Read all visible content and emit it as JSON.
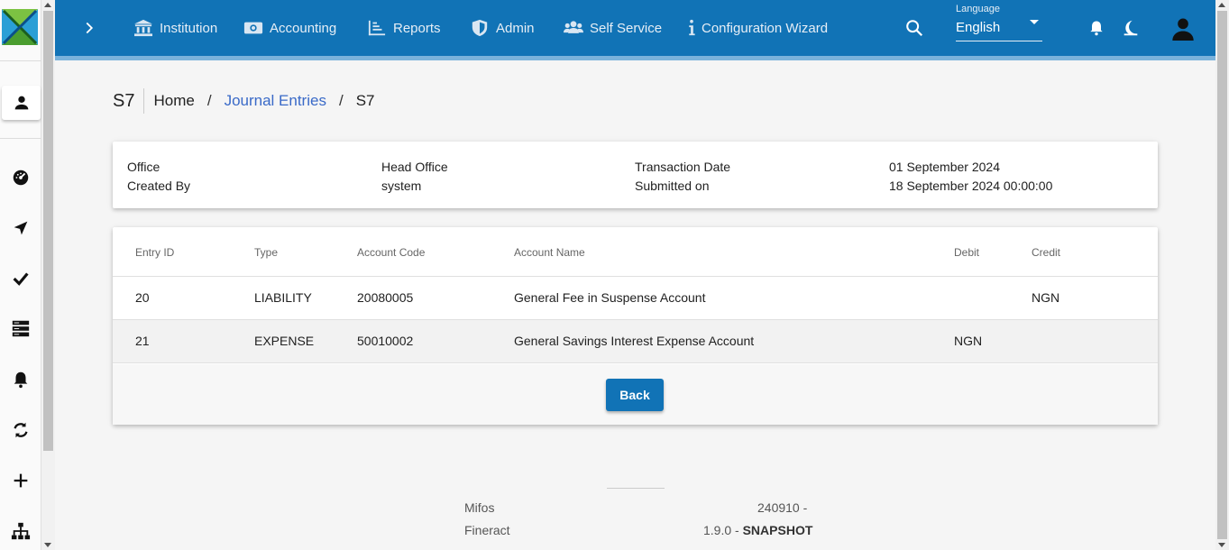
{
  "nav": {
    "items": [
      {
        "label": "Institution",
        "icon": "institution-icon"
      },
      {
        "label": "Accounting",
        "icon": "money-icon"
      },
      {
        "label": "Reports",
        "icon": "reports-icon"
      },
      {
        "label": "Admin",
        "icon": "shield-icon"
      },
      {
        "label": "Self Service",
        "icon": "users-icon"
      },
      {
        "label": "Configuration Wizard",
        "icon": "info-icon"
      }
    ],
    "language_label": "Language",
    "language_value": "English"
  },
  "breadcrumb": {
    "page_title": "S7",
    "home": "Home",
    "section": "Journal Entries",
    "current": "S7"
  },
  "info": {
    "office_label": "Office",
    "created_by_label": "Created By",
    "office_value": "Head Office",
    "created_by_value": "system",
    "transaction_date_label": "Transaction Date",
    "submitted_on_label": "Submitted on",
    "transaction_date_value": "01 September 2024",
    "submitted_on_value": "18 September 2024 00:00:00"
  },
  "table": {
    "headers": [
      "Entry ID",
      "Type",
      "Account Code",
      "Account Name",
      "Debit",
      "Credit"
    ],
    "rows": [
      {
        "entry_id": "20",
        "type": "LIABILITY",
        "account_code": "20080005",
        "account_name": "General Fee in Suspense Account",
        "debit": "",
        "credit": "NGN"
      },
      {
        "entry_id": "21",
        "type": "EXPENSE",
        "account_code": "50010002",
        "account_name": "General Savings Interest Expense Account",
        "debit": "NGN",
        "credit": ""
      }
    ],
    "back_label": "Back"
  },
  "footer": {
    "mifos_label": "Mifos",
    "mifos_version": "240910 -",
    "fineract_label": "Fineract",
    "fineract_version": "1.9.0 -",
    "fineract_tag": "SNAPSHOT"
  },
  "colors": {
    "primary": "#1173b6",
    "link": "#3a6ac8"
  }
}
